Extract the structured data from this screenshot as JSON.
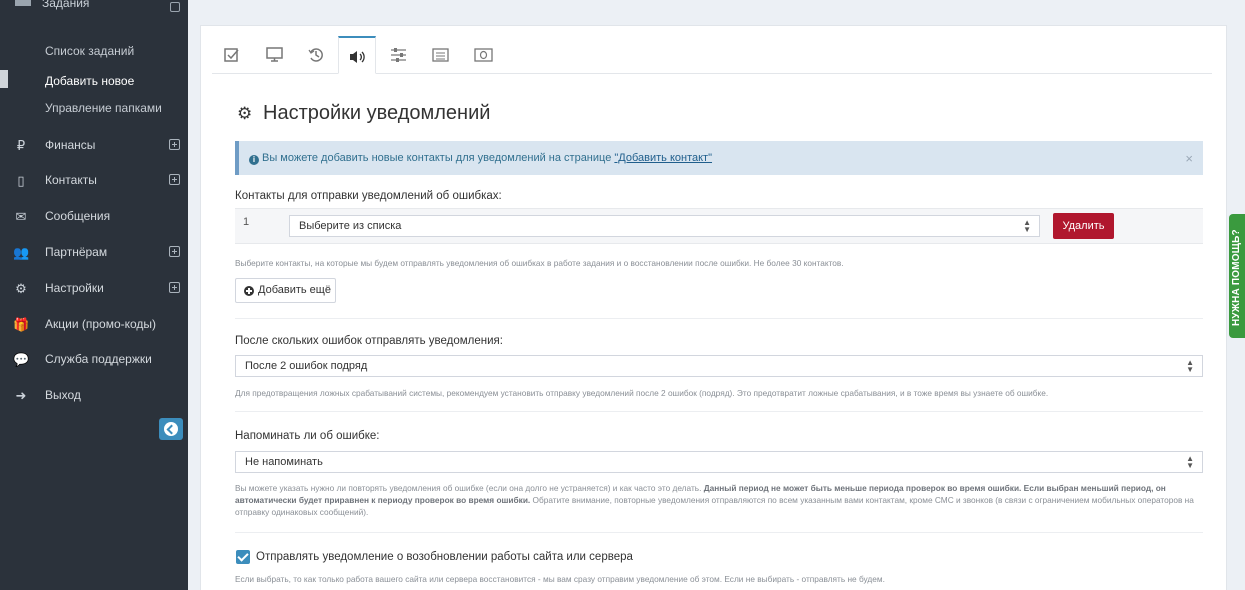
{
  "sidebar": {
    "top_item": "Задания",
    "submenu": [
      "Список заданий",
      "Добавить новое",
      "Управление папками"
    ],
    "items": [
      {
        "label": "Финансы",
        "icon": "ruble-icon",
        "glyph": "₽"
      },
      {
        "label": "Контакты",
        "icon": "phone-icon",
        "glyph": "▯"
      },
      {
        "label": "Сообщения",
        "icon": "envelope-icon",
        "glyph": "✉"
      },
      {
        "label": "Партнёрам",
        "icon": "users-icon",
        "glyph": "👥"
      },
      {
        "label": "Настройки",
        "icon": "gear-icon",
        "glyph": "⚙"
      },
      {
        "label": "Акции (промо-коды)",
        "icon": "gift-icon",
        "glyph": "🎁"
      },
      {
        "label": "Служба поддержки",
        "icon": "comments-icon",
        "glyph": "💬"
      },
      {
        "label": "Выход",
        "icon": "sign-out-icon",
        "glyph": "➜"
      }
    ]
  },
  "page": {
    "title": "Настройки уведомлений",
    "alert_text": "Вы можете добавить новые контакты для уведомлений на странице ",
    "alert_link": "\"Добавить контакт\"",
    "alert_close": "×"
  },
  "contacts": {
    "label": "Контакты для отправки уведомлений об ошибках:",
    "row_num": "1",
    "select_value": "Выберите из списка",
    "delete_label": "Удалить",
    "help": "Выберите контакты, на которые мы будем отправлять уведомления об ошибках в работе задания и о восстановлении после ошибки. Не более 30 контактов.",
    "add_label": "Добавить ещё"
  },
  "errors_threshold": {
    "label": "После скольких ошибок отправлять уведомления:",
    "value": "После 2 ошибок подряд",
    "help": "Для предотвращения ложных срабатываний системы, рекомендуем установить отправку уведомлений после 2 ошибок (подряд). Это предотвратит ложные срабатывания, и в тоже время вы узнаете об ошибке."
  },
  "remind": {
    "label": "Напоминать ли об ошибке:",
    "value": "Не напоминать",
    "help_pre": "Вы можете указать нужно ли повторять уведомления об ошибке (если она долго не устраняется) и как часто это делать. ",
    "help_bold": "Данный период не может быть меньше периода проверок во время ошибки. Если выбран меньший период, он автоматически будет приравнен к периоду проверок во время ошибки.",
    "help_post": " Обратите внимание, повторные уведомления отправляются по всем указанным вами контактам, кроме СМС и звонков (в связи с ограничением мобильных операторов на отправку одинаковых сообщений)."
  },
  "recovery": {
    "label": "Отправлять уведомление о возобновлении работы сайта или сервера",
    "checked": true,
    "help": "Если выбрать, то как только работа вашего сайта или сервера восстановится - мы вам сразу отправим уведомление об этом. Если не выбирать - отправлять не будем."
  },
  "help_tab": "НУЖНА ПОМОЩЬ?",
  "colors": {
    "sidebar_bg": "#2b323b",
    "accent": "#3c8dbc",
    "danger": "#b0172e",
    "help_green": "#3a9a3e"
  }
}
